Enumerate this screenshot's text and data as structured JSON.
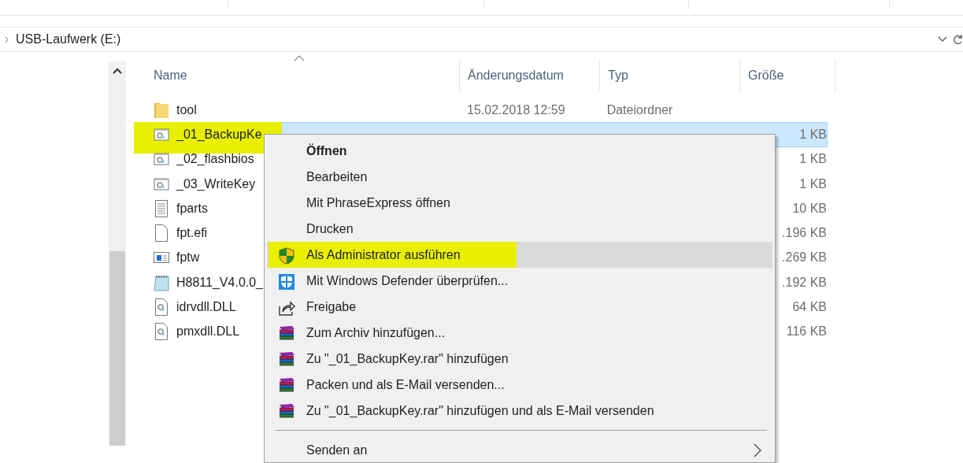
{
  "address_bar": {
    "path": "USB-Laufwerk (E:)"
  },
  "file_list": {
    "columns": [
      "Name",
      "Änderungsdatum",
      "Typ",
      "Größe"
    ],
    "rows": [
      {
        "kind": "folder",
        "name": "tool",
        "date": "15.02.2018 12:59",
        "type": "Dateiordner",
        "size": "",
        "selected": false,
        "highlighted": false
      },
      {
        "kind": "batch",
        "name": "_01_BackupKe",
        "date": "",
        "type": "",
        "size": "1 KB",
        "selected": true,
        "highlighted": true
      },
      {
        "kind": "batch",
        "name": "_02_flashbios",
        "date": "",
        "type": "",
        "size": "1 KB",
        "selected": false,
        "highlighted": false
      },
      {
        "kind": "batch",
        "name": "_03_WriteKey",
        "date": "",
        "type": "",
        "size": "1 KB",
        "selected": false,
        "highlighted": false
      },
      {
        "kind": "text",
        "name": "fparts",
        "date": "",
        "type": "",
        "size": "10 KB",
        "selected": false,
        "highlighted": false
      },
      {
        "kind": "file",
        "name": "fpt.efi",
        "date": "",
        "type": "",
        "size": ".196 KB",
        "selected": false,
        "highlighted": false
      },
      {
        "kind": "app",
        "name": "fptw",
        "date": "",
        "type": "",
        "size": ".269 KB",
        "selected": false,
        "highlighted": false
      },
      {
        "kind": "notepad",
        "name": "H8811_V4.0.0_",
        "date": "",
        "type": "",
        "size": ".192 KB",
        "selected": false,
        "highlighted": false
      },
      {
        "kind": "dll",
        "name": "idrvdll.DLL",
        "date": "",
        "type": "",
        "size": "64 KB",
        "selected": false,
        "highlighted": false
      },
      {
        "kind": "dll",
        "name": "pmxdll.DLL",
        "date": "",
        "type": "",
        "size": "116 KB",
        "selected": false,
        "highlighted": false
      }
    ]
  },
  "context_menu": {
    "items": [
      {
        "kind": "plain",
        "label": "Öffnen",
        "default": true,
        "selected": false,
        "highlighted": false
      },
      {
        "kind": "plain",
        "label": "Bearbeiten",
        "default": false,
        "selected": false,
        "highlighted": false
      },
      {
        "kind": "plain",
        "label": "Mit PhraseExpress öffnen",
        "default": false,
        "selected": false,
        "highlighted": false
      },
      {
        "kind": "plain",
        "label": "Drucken",
        "default": false,
        "selected": false,
        "highlighted": false
      },
      {
        "kind": "shield",
        "label": "Als Administrator ausführen",
        "default": false,
        "selected": true,
        "highlighted": true
      },
      {
        "kind": "defender",
        "label": "Mit Windows Defender überprüfen...",
        "default": false,
        "selected": false,
        "highlighted": false
      },
      {
        "kind": "share",
        "label": "Freigabe",
        "default": false,
        "selected": false,
        "highlighted": false
      },
      {
        "kind": "archive",
        "label": "Zum Archiv hinzufügen...",
        "default": false,
        "selected": false,
        "highlighted": false
      },
      {
        "kind": "archive",
        "label": "Zu \"_01_BackupKey.rar\" hinzufügen",
        "default": false,
        "selected": false,
        "highlighted": false
      },
      {
        "kind": "archive",
        "label": "Packen und als E-Mail versenden...",
        "default": false,
        "selected": false,
        "highlighted": false
      },
      {
        "kind": "archive",
        "label": "Zu \"_01_BackupKey.rar\" hinzufügen und als E-Mail versenden",
        "default": false,
        "selected": false,
        "highlighted": false
      },
      {
        "kind": "separator"
      },
      {
        "kind": "submenu",
        "label": "Senden an",
        "default": false,
        "selected": false,
        "highlighted": false
      }
    ]
  }
}
